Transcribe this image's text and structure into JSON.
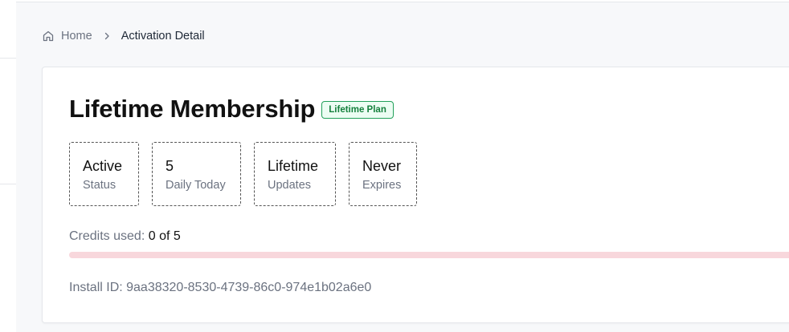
{
  "breadcrumb": {
    "home_label": "Home",
    "home_icon": "home-icon",
    "separator_icon": "chevron-right-icon",
    "current_label": "Activation Detail"
  },
  "card": {
    "title": "Lifetime Membership",
    "plan_badge": "Lifetime Plan",
    "stats": [
      {
        "value": "Active",
        "label": "Status"
      },
      {
        "value": "5",
        "label": "Daily Today"
      },
      {
        "value": "Lifetime",
        "label": "Updates"
      },
      {
        "value": "Never",
        "label": "Expires"
      }
    ],
    "credits": {
      "label": "Credits used:",
      "value": "0 of 5",
      "used": 0,
      "total": 5
    },
    "install_id": "Install ID: 9aa38320-8530-4739-86c0-974e1b02a6e0"
  },
  "colors": {
    "badge_text": "#15803d",
    "badge_border": "#22a05a",
    "progress_track": "#f8d7dc"
  }
}
